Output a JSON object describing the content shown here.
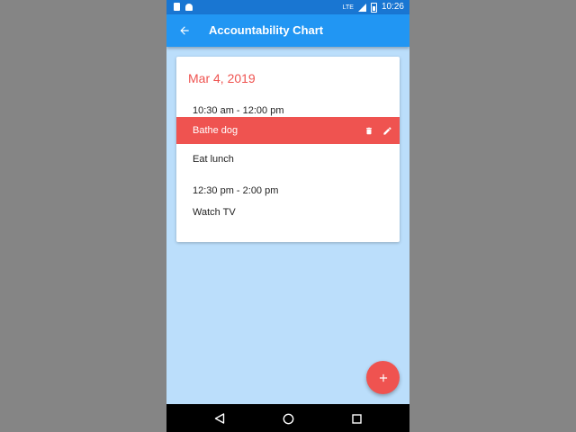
{
  "status_bar": {
    "network": "LTE",
    "time": "10:26"
  },
  "app_bar": {
    "title": "Accountability Chart",
    "back_icon": "arrow-back-icon"
  },
  "card": {
    "date": "Mar 4, 2019",
    "groups": [
      {
        "time_range": "10:30 am - 12:00 pm",
        "events": [
          {
            "label": "Bathe dog",
            "selected": true
          },
          {
            "label": "Eat lunch",
            "selected": false
          }
        ]
      },
      {
        "time_range": "12:30 pm - 2:00 pm",
        "events": [
          {
            "label": "Watch TV",
            "selected": false
          }
        ]
      }
    ],
    "actions": {
      "delete_icon": "trash-icon",
      "edit_icon": "pencil-icon"
    }
  },
  "fab": {
    "icon": "plus-icon"
  },
  "nav_bar": {
    "back_icon": "triangle-back-icon",
    "home_icon": "circle-home-icon",
    "recents_icon": "square-recents-icon"
  },
  "colors": {
    "status_bar": "#1976d2",
    "app_bar": "#2196f3",
    "background": "#bbdefb",
    "accent": "#ef5350",
    "card": "#ffffff"
  }
}
